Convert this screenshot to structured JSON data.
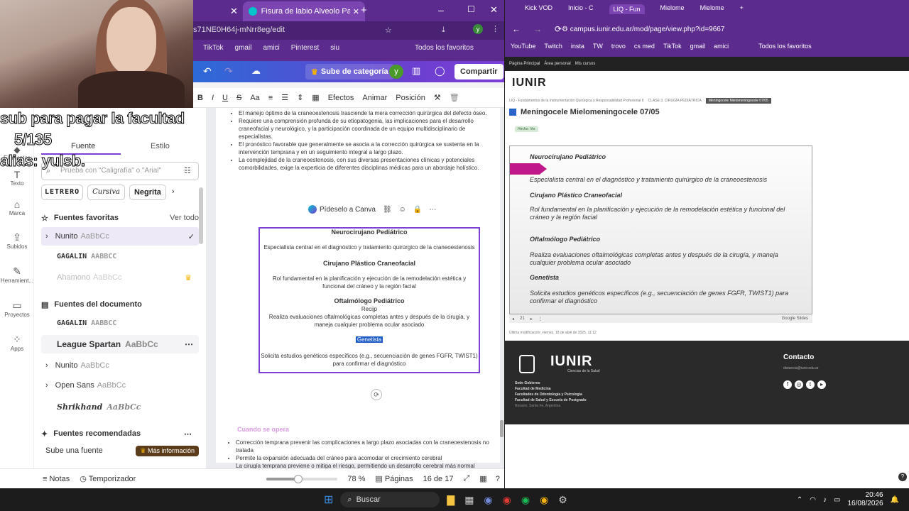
{
  "overlay": {
    "line1": "sub para pagar la facultad",
    "line2": "5/135",
    "line3": "alias: yulsb."
  },
  "mid_browser": {
    "tab_title": "Fisura de labio Alveolo Palatina",
    "address": "s71NE0H64j-mNrr8eg/edit",
    "bookmarks": [
      "TikTok",
      "gmail",
      "amici",
      "Pinterest",
      "siu"
    ],
    "bookmarks_all": "Todos los favoritos"
  },
  "canva_top": {
    "upgrade_label": "Sube de categoría",
    "avatar_letter": "y",
    "share_label": "Compartir"
  },
  "canva_format": {
    "effects": "Efectos",
    "animate": "Animar",
    "position": "Posición",
    "text_size": "Aa"
  },
  "rail": [
    {
      "icon": "elements-icon",
      "label": "Elementos"
    },
    {
      "icon": "text-icon",
      "label": "Texto"
    },
    {
      "icon": "brand-icon",
      "label": "Marca"
    },
    {
      "icon": "upload-icon",
      "label": "Subidos"
    },
    {
      "icon": "tools-icon",
      "label": "Herramient..."
    },
    {
      "icon": "folder-icon",
      "label": "Proyectos"
    },
    {
      "icon": "apps-icon",
      "label": "Apps"
    }
  ],
  "font_panel": {
    "tab_font": "Fuente",
    "tab_style": "Estilo",
    "search_placeholder": "Prueba con \"Caligrafía\" o \"Arial\"",
    "chips": [
      "LETRERO",
      "Cursiva",
      "Negrita"
    ],
    "favorites_title": "Fuentes favoritas",
    "see_all": "Ver todo",
    "favorites": [
      {
        "name": "Nunito",
        "sample": "AaBbCc"
      },
      {
        "name": "GAGALIN",
        "sample": "AABBCC"
      },
      {
        "name": "Ahamono",
        "sample": "AaBbCc"
      }
    ],
    "doc_fonts_title": "Fuentes del documento",
    "doc_fonts": [
      {
        "name": "GAGALIN",
        "sample": "AABBCC"
      },
      {
        "name": "League Spartan",
        "sample": "AaBbCc"
      },
      {
        "name": "Nunito",
        "sample": "AaBbCc"
      },
      {
        "name": "Open Sans",
        "sample": "AaBbCc"
      },
      {
        "name": "Shrikhand",
        "sample": "AaBbCc"
      }
    ],
    "recommended_title": "Fuentes recomendadas",
    "upload_font": "Sube una fuente",
    "more_info": "Más información"
  },
  "doc": {
    "bullets_top": [
      "El manejo óptimo de la craneoestenosis trasciende la mera corrección quirúrgica del defecto óseo.",
      "Requiere una comprensión profunda de su etiopatogenia, las implicaciones para el desarrollo craneofacial y neurológico, y la participación coordinada de un equipo multidisciplinario de especialistas.",
      "El pronóstico favorable que generalmente se asocia a la corrección quirúrgica se sustenta en la intervención temprana y en un seguimiento integral a largo plazo.",
      "La complejidad de la craneoestenosis, con sus diversas presentaciones clínicas y potenciales comorbilidades, exige la experticia de diferentes disciplinas médicas para un abordaje holístico."
    ],
    "ask_canva": "Pídeselo a Canva",
    "box": [
      {
        "title": "Neurocirujano Pediátrico",
        "text": "Especialista central en el diagnóstico y tratamiento quirúrgico de la craneoestenosis"
      },
      {
        "title": "Cirujano Plástico Craneofacial",
        "text": "Rol fundamental en la planificación y ejecución de la remodelación estética y funcional del cráneo y la región facial"
      },
      {
        "title": "Oftalmólogo Pediátrico",
        "extra": "Recijp",
        "text": "Realiza evaluaciones oftalmológicas completas antes y después de la cirugía, y maneja cualquier problema ocular asociado"
      },
      {
        "title": "Genetista",
        "text": "Solicita estudios genéticos específicos (e.g., secuenciación de genes FGFR, TWIST1) para confirmar el diagnóstico"
      }
    ],
    "section_heading": "Cuando se opera",
    "bullets_bottom": [
      "Corrección temprana prevenir las complicaciones a largo plazo asociadas con la craneoestenosis no tratada",
      "Permite la expansión adecuada del cráneo para acomodar el crecimiento cerebral",
      "La cirugía temprana previene o mitiga el riesgo, permitiendo un desarrollo cerebral más normal"
    ]
  },
  "bottom_bar": {
    "notes": "Notas",
    "timer": "Temporizador",
    "zoom": "78 %",
    "pages_label": "Páginas",
    "page_count": "16 de 17",
    "zoom_fraction": 0.45
  },
  "right_browser": {
    "tabs": [
      "Kick VOD",
      "Inicio - C",
      "LIQ - Fun",
      "Mielome",
      "Mielome"
    ],
    "address": "campus.iunir.edu.ar/mod/page/view.php?id=9667",
    "bookmarks": [
      "YouTube",
      "Twitch",
      "insta",
      "TW",
      "trovo",
      "cs med",
      "TikTok",
      "gmail",
      "amici"
    ],
    "bookmarks_all": "Todos los favoritos",
    "nav": [
      "Página Principal",
      "Área personal",
      "Mis cursos"
    ],
    "logo": "IUNIR",
    "breadcrumb": [
      "LIQ - Fundamentos de la Instrumentación Quirúrgica y Responsabilidad Profesional II",
      "CLASE 3. CIRUGÍA PEDIÁTRICA",
      "Meningocele Mielomeningocele 07/05"
    ],
    "page_title": "Meningocele Mielomeningocele 07/05",
    "done_badge": "Hecho: Ver",
    "slide": [
      {
        "title": "Neurocirujano Pediátrico",
        "text": "Especialista central en el diagnóstico y tratamiento quirúrgico de la craneoestenosis"
      },
      {
        "title": "Cirujano Plástico Craneofacial",
        "text": "Rol fundamental en la planificación y ejecución de la remodelación estética y funcional del cráneo y la región facial"
      },
      {
        "title": "Oftalmólogo Pediátrico",
        "text": "Realiza evaluaciones oftalmológicas completas antes y después de la cirugía, y maneja cualquier problema ocular asociado"
      },
      {
        "title": "Genetista",
        "text": "Solicita estudios genéticos específicos (e.g., secuenciación de genes FGFR, TWIST1) para confirmar el diagnóstico"
      }
    ],
    "slide_page": "21",
    "google_slides": "Google Slides",
    "last_modified": "Última modificación: viernes, 18 de abril de 2025, 11:12",
    "footer": {
      "logo": "IUNIR",
      "tagline": "Ciencias de la Salud",
      "lines": [
        "Sede Gobierno",
        "Facultad de Medicina",
        "Facultades de Odontología y Psicología",
        "Facultad de Salud y Escuela de Postgrado",
        "Rosario, Santa Fe, Argentina"
      ],
      "contact_title": "Contacto",
      "contact_email": "distancia@iunir.edu.ar"
    }
  },
  "taskbar": {
    "search": "Buscar",
    "time": "20:46",
    "date": "16/08/2026"
  },
  "colors": {
    "canva_purple": "#7b3fd6",
    "chrome_purple": "#5b2b8e",
    "accent_magenta": "#c0188a"
  }
}
